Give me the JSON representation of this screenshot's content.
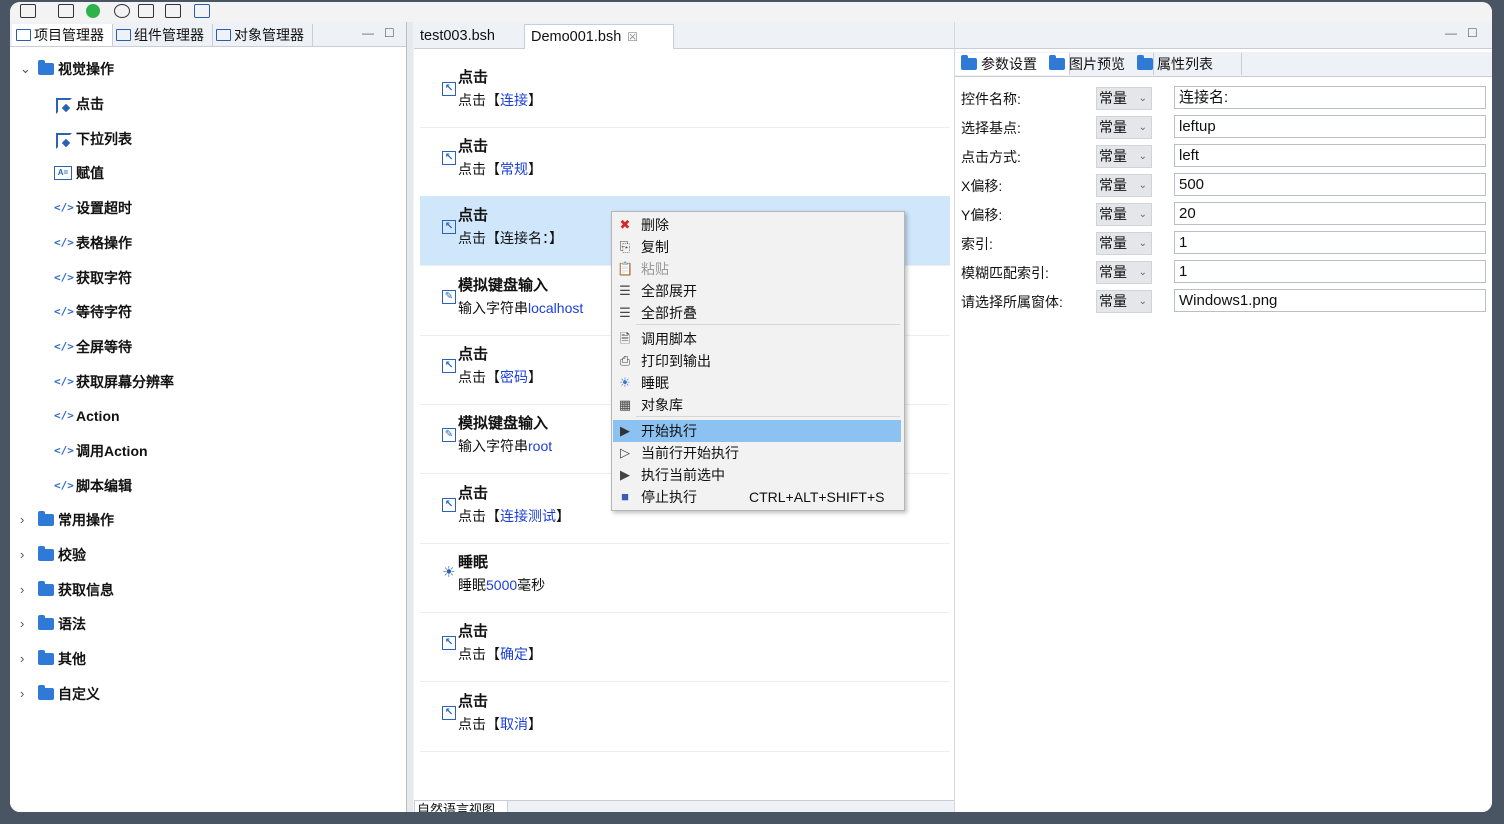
{
  "left_panel": {
    "tabs": [
      "项目管理器",
      "组件管理器",
      "对象管理器"
    ],
    "tree": {
      "root": "视觉操作",
      "children": [
        "点击",
        "下拉列表",
        "赋值",
        "设置超时",
        "表格操作",
        "获取字符",
        "等待字符",
        "全屏等待",
        "获取屏幕分辨率",
        "Action",
        "调用Action",
        "脚本编辑"
      ],
      "groups": [
        "常用操作",
        "校验",
        "获取信息",
        "语法",
        "其他",
        "自定义"
      ]
    }
  },
  "editor": {
    "tabs": [
      "test003.bsh",
      "Demo001.bsh"
    ],
    "close_glyph": "☒",
    "steps": [
      {
        "title": "点击",
        "prefix": "点击【",
        "param": "连接",
        "suffix": "】"
      },
      {
        "title": "点击",
        "prefix": "点击【",
        "param": "常规",
        "suffix": "】"
      },
      {
        "title": "点击",
        "prefix": "点击【连接名：】",
        "param": "",
        "suffix": ""
      },
      {
        "title": "模拟键盘输入",
        "prefix": "输入字符串",
        "param": "localhost",
        "suffix": ""
      },
      {
        "title": "点击",
        "prefix": "点击【",
        "param": "密码",
        "suffix": "】"
      },
      {
        "title": "模拟键盘输入",
        "prefix": "输入字符串",
        "param": "root",
        "suffix": ""
      },
      {
        "title": "点击",
        "prefix": "点击【",
        "param": "连接测试",
        "suffix": "】"
      },
      {
        "title": "睡眠",
        "prefix": "睡眠",
        "param": "5000",
        "suffix": "毫秒"
      },
      {
        "title": "点击",
        "prefix": "点击【",
        "param": "确定",
        "suffix": "】"
      },
      {
        "title": "点击",
        "prefix": "点击【",
        "param": "取消",
        "suffix": "】"
      }
    ],
    "bottom_tab": "自然语言视图"
  },
  "context_menu": {
    "items": [
      {
        "label": "删除",
        "icon": "delete-icon",
        "glyph": "✖"
      },
      {
        "label": "复制",
        "icon": "copy-icon",
        "glyph": "⎘"
      },
      {
        "label": "粘贴",
        "icon": "paste-icon",
        "glyph": "📋"
      },
      {
        "label": "全部展开",
        "icon": "expand-all-icon",
        "glyph": "☰"
      },
      {
        "label": "全部折叠",
        "icon": "collapse-all-icon",
        "glyph": "☰"
      },
      {
        "label": "调用脚本",
        "icon": "call-script-icon",
        "glyph": "🗎"
      },
      {
        "label": "打印到输出",
        "icon": "print-icon",
        "glyph": "⎙"
      },
      {
        "label": "睡眠",
        "icon": "sleep-icon",
        "glyph": "☀"
      },
      {
        "label": "对象库",
        "icon": "object-library-icon",
        "glyph": "▦"
      },
      {
        "label": "开始执行",
        "icon": "run-icon",
        "glyph": "▶"
      },
      {
        "label": "当前行开始执行",
        "icon": "run-from-line-icon",
        "glyph": "▷"
      },
      {
        "label": "执行当前选中",
        "icon": "run-selected-icon",
        "glyph": "▶"
      },
      {
        "label": "停止执行",
        "icon": "stop-icon",
        "glyph": "■",
        "shortcut": "CTRL+ALT+SHIFT+S"
      }
    ]
  },
  "right_panel": {
    "tabs": [
      "参数设置",
      "图片预览",
      "属性列表"
    ],
    "params": [
      {
        "label": "控件名称:",
        "mode": "常量",
        "value": "连接名:"
      },
      {
        "label": "选择基点:",
        "mode": "常量",
        "value": "leftup"
      },
      {
        "label": "点击方式:",
        "mode": "常量",
        "value": "left"
      },
      {
        "label": "X偏移:",
        "mode": "常量",
        "value": "500"
      },
      {
        "label": "Y偏移:",
        "mode": "常量",
        "value": "20"
      },
      {
        "label": "索引:",
        "mode": "常量",
        "value": "1"
      },
      {
        "label": "模糊匹配索引:",
        "mode": "常量",
        "value": "1"
      },
      {
        "label": "请选择所属窗体:",
        "mode": "常量",
        "value": "Windows1.png"
      }
    ]
  },
  "colors": {
    "accent": "#2e7ad6",
    "selection": "#cfe6fb",
    "menu_highlight": "#8cc2f2",
    "param_text": "#1a3fd6"
  }
}
